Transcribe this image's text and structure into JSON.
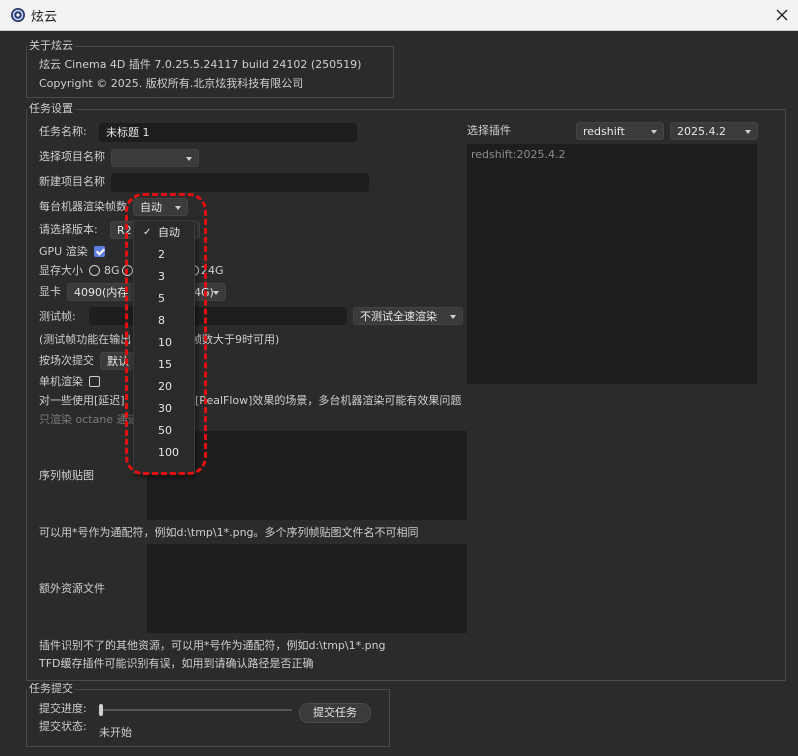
{
  "window": {
    "title": "炫云"
  },
  "about": {
    "group_title": "关于炫云",
    "version_line": "炫云 Cinema 4D 插件 7.0.25.5.24117 build 24102  (250519)",
    "copyright": "Copyright © 2025. 版权所有.北京炫我科技有限公司"
  },
  "task_settings": {
    "group_title": "任务设置",
    "task_name_label": "任务名称:",
    "task_name_value": "未标题 1",
    "select_project_label": "选择项目名称",
    "select_project_value": "",
    "new_project_label": "新建项目名称",
    "new_project_value": "",
    "frames_per_machine_label": "每台机器渲染帧数",
    "frames_per_machine_value": "自动",
    "version_label": "请选择版本:",
    "version_value": "R2",
    "gpu_label": "GPU 渲染",
    "gpu_checked": true,
    "vram_label": "显存大小",
    "vram_option_8g": "8G",
    "vram_option_24g": "24G",
    "gpu_card_label": "显卡",
    "gpu_card_value_left": "4090(内存 1",
    "gpu_card_value_right": "4G)",
    "test_frame_label": "测试帧:",
    "test_frame_value": "",
    "test_mode_value": "不测试全速渲染",
    "test_note_left": "(测试帧功能在输出",
    "test_note_right": "帧数大于9时可用)",
    "submit_by_scene_label": "按场次提交",
    "submit_by_scene_value": "默认",
    "single_machine_label": "单机渲染",
    "single_machine_checked": false,
    "warning_left": "对一些使用[延迟]",
    "warning_right": "[RealFlow]效果的场景，多台机器渲染可能有效果问题",
    "octane_note": "只渲染 octane 通道",
    "sequence_label": "序列帧贴图",
    "sequence_value": "",
    "sequence_hint": "可以用*号作为通配符，例如d:\\tmp\\1*.png。多个序列帧贴图文件名不可相同",
    "extra_label": "额外资源文件",
    "extra_value": "",
    "extra_hint": "插件识别不了的其他资源，可以用*号作为通配符，例如d:\\tmp\\1*.png",
    "tfd_hint": "TFD缓存插件可能识别有误，如用到请确认路径是否正确",
    "plugin_label": "选择插件",
    "plugin_value": "redshift",
    "plugin_version_value": "2025.4.2",
    "plugin_list": [
      "redshift:2025.4.2"
    ]
  },
  "frames_dropdown": {
    "options": [
      "自动",
      "2",
      "3",
      "5",
      "8",
      "10",
      "15",
      "20",
      "30",
      "50",
      "100"
    ],
    "selected": "自动"
  },
  "submit": {
    "group_title": "任务提交",
    "progress_label": "提交进度:",
    "progress": 0,
    "status_label": "提交状态:",
    "status_value": "未开始",
    "submit_button": "提交任务"
  },
  "colors": {
    "highlight": "#e01010",
    "accent": "#5d7de0"
  }
}
